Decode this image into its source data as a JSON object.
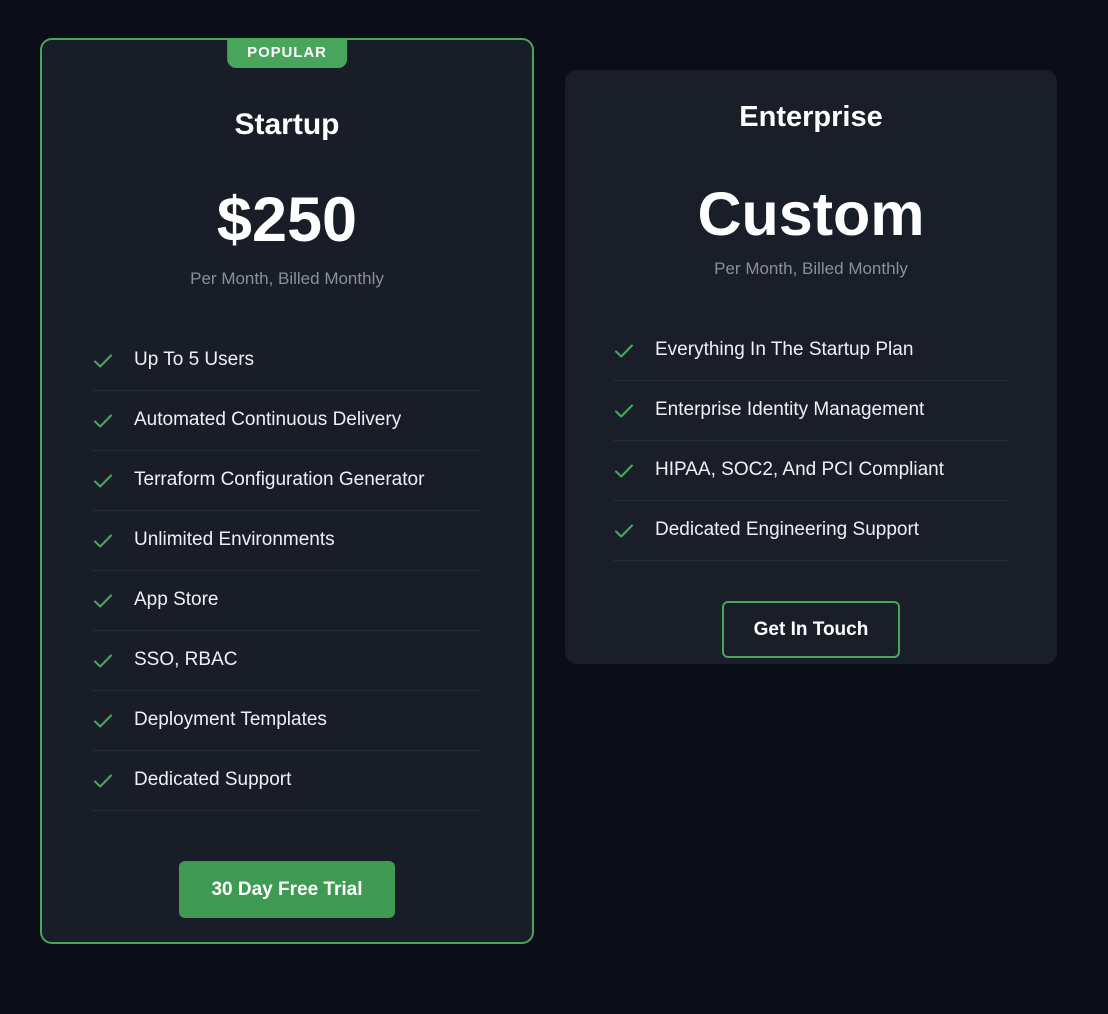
{
  "plans": [
    {
      "id": "startup",
      "badge": "POPULAR",
      "name": "Startup",
      "price": "$250",
      "period": "Per Month, Billed Monthly",
      "features": [
        "Up To 5 Users",
        "Automated Continuous Delivery",
        "Terraform Configuration Generator",
        "Unlimited Environments",
        "App Store",
        "SSO, RBAC",
        "Deployment Templates",
        "Dedicated Support"
      ],
      "cta": "30 Day Free Trial"
    },
    {
      "id": "enterprise",
      "name": "Enterprise",
      "price": "Custom",
      "period": "Per Month, Billed Monthly",
      "features": [
        "Everything In The Startup Plan",
        "Enterprise Identity Management",
        "HIPAA, SOC2, And PCI Compliant",
        "Dedicated Engineering Support"
      ],
      "cta": "Get In Touch"
    }
  ],
  "icons": {
    "check": "check-icon"
  },
  "colors": {
    "page_background": "#0b0e17",
    "card_background": "#1b1f29",
    "accent_green": "#49a45c",
    "button_green": "#3f9a53",
    "text_primary": "#ffffff",
    "text_muted": "#8a8f9a",
    "divider": "#262b36"
  }
}
